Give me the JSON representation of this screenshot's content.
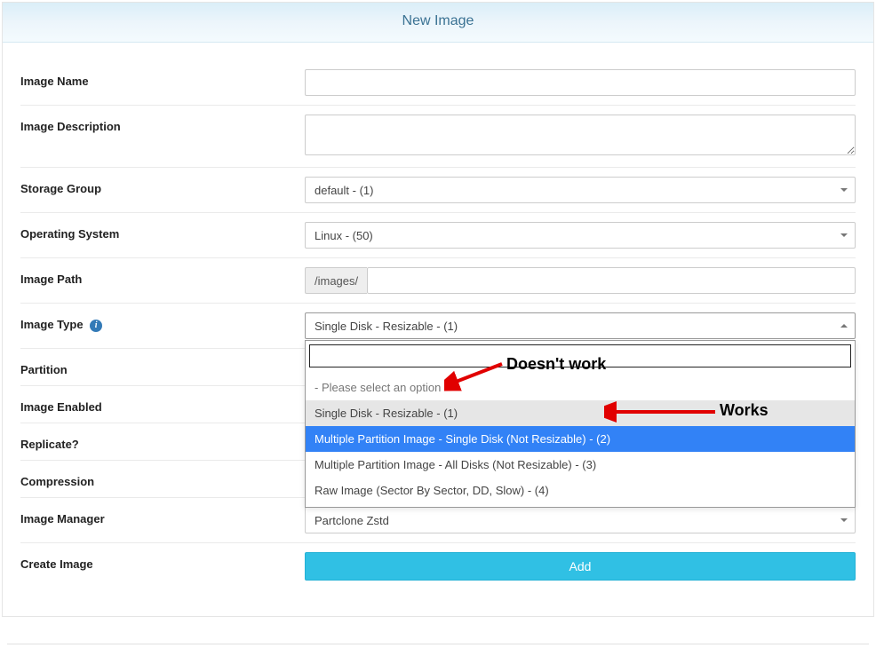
{
  "header": {
    "title": "New Image"
  },
  "labels": {
    "image_name": "Image Name",
    "image_description": "Image Description",
    "storage_group": "Storage Group",
    "operating_system": "Operating System",
    "image_path": "Image Path",
    "image_type": "Image Type",
    "partition": "Partition",
    "image_enabled": "Image Enabled",
    "replicate": "Replicate?",
    "compression": "Compression",
    "image_manager": "Image Manager",
    "create_image": "Create Image"
  },
  "values": {
    "image_name": "",
    "image_description": "",
    "storage_group": "default - (1)",
    "operating_system": "Linux - (50)",
    "image_path_prefix": "/images/",
    "image_path": "",
    "image_type_selected": "Single Disk - Resizable - (1)",
    "image_manager": "Partclone Zstd"
  },
  "image_type_options": {
    "placeholder": "- Please select an option -",
    "opt1": "Single Disk - Resizable - (1)",
    "opt2": "Multiple Partition Image - Single Disk (Not Resizable) - (2)",
    "opt3": "Multiple Partition Image - All Disks (Not Resizable) - (3)",
    "opt4": "Raw Image (Sector By Sector, DD, Slow) - (4)"
  },
  "buttons": {
    "add": "Add"
  },
  "info_icon_glyph": "i",
  "annotations": {
    "doesnt_work": "Doesn't work",
    "works": "Works"
  }
}
